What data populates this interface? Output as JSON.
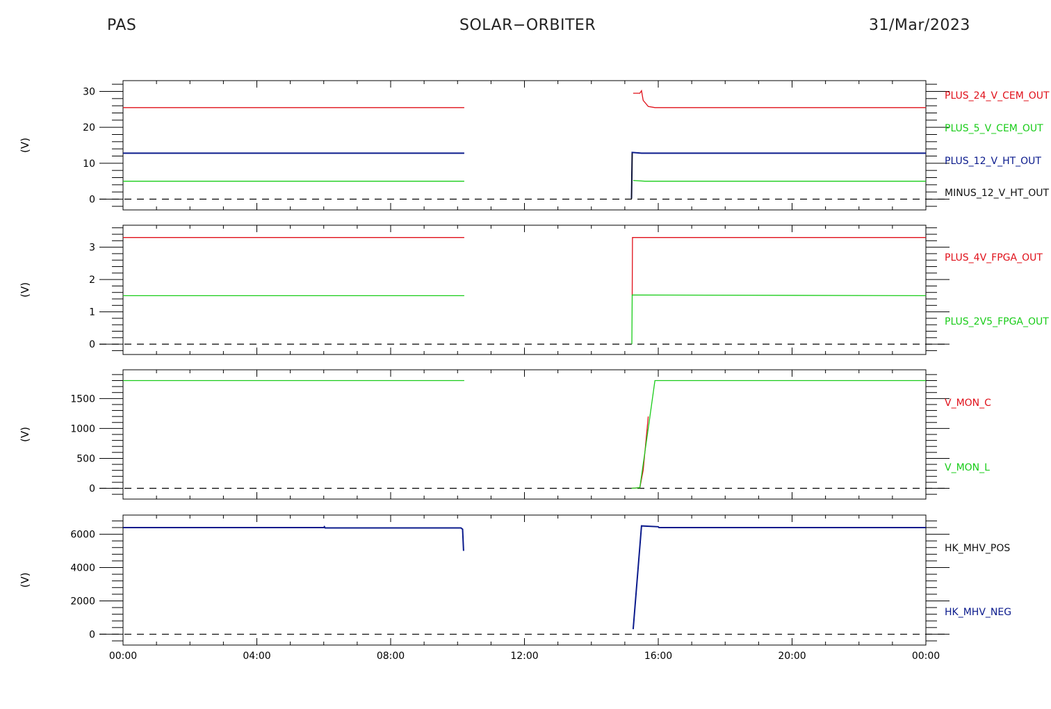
{
  "header": {
    "left": "PAS",
    "center": "SOLAR−ORBITER",
    "right": "31/Mar/2023"
  },
  "x_ticks": [
    "00:00",
    "04:00",
    "08:00",
    "12:00",
    "16:00",
    "20:00",
    "00:00"
  ],
  "chart_data": [
    {
      "type": "line",
      "ylabel": "(V)",
      "ylim": [
        -3,
        33
      ],
      "yticks": [
        0,
        10,
        20,
        30
      ],
      "xlim": [
        0,
        24
      ],
      "series": [
        {
          "name": "PLUS_24_V_CEM_OUT",
          "color": "#e0101a",
          "segments": [
            [
              [
                0,
                25.5
              ],
              [
                10.2,
                25.5
              ]
            ],
            [
              [
                15.25,
                29.5
              ],
              [
                15.45,
                29.5
              ],
              [
                15.5,
                30.2
              ],
              [
                15.55,
                27.5
              ],
              [
                15.7,
                25.8
              ],
              [
                15.9,
                25.5
              ],
              [
                24,
                25.5
              ]
            ]
          ]
        },
        {
          "name": "PLUS_5_V_CEM_OUT",
          "color": "#19cc19",
          "segments": [
            [
              [
                0,
                5.0
              ],
              [
                10.2,
                5.0
              ]
            ],
            [
              [
                15.25,
                5.2
              ],
              [
                15.6,
                5.0
              ],
              [
                24,
                5.0
              ]
            ]
          ]
        },
        {
          "name": "PLUS_12_V_HT_OUT",
          "color": "#0a1a8c",
          "segments": [
            [
              [
                0,
                12.8
              ],
              [
                10.2,
                12.8
              ]
            ],
            [
              [
                15.2,
                0.2
              ],
              [
                15.22,
                13.0
              ],
              [
                15.5,
                12.8
              ],
              [
                24,
                12.8
              ]
            ]
          ]
        },
        {
          "name": "MINUS_12_V_HT_OUT",
          "color": "#111111",
          "segments": [
            [
              [
                15.2,
                0.0
              ],
              [
                15.22,
                12.8
              ]
            ]
          ]
        }
      ]
    },
    {
      "type": "line",
      "ylabel": "(V)",
      "ylim": [
        -0.32,
        3.68
      ],
      "yticks": [
        0,
        1,
        2,
        3
      ],
      "xlim": [
        0,
        24
      ],
      "series": [
        {
          "name": "PLUS_4V_FPGA_OUT",
          "color": "#e0101a",
          "segments": [
            [
              [
                0,
                3.3
              ],
              [
                10.2,
                3.3
              ]
            ],
            [
              [
                15.22,
                1.5
              ],
              [
                15.23,
                3.3
              ],
              [
                24,
                3.3
              ]
            ]
          ]
        },
        {
          "name": "PLUS_2V5_FPGA_OUT",
          "color": "#19cc19",
          "segments": [
            [
              [
                0,
                1.5
              ],
              [
                10.2,
                1.5
              ]
            ],
            [
              [
                15.21,
                0.0
              ],
              [
                15.22,
                1.52
              ],
              [
                24,
                1.5
              ]
            ]
          ]
        }
      ]
    },
    {
      "type": "line",
      "ylabel": "(V)",
      "ylim": [
        -180,
        1980
      ],
      "yticks": [
        0,
        500,
        1000,
        1500
      ],
      "xlim": [
        0,
        24
      ],
      "series": [
        {
          "name": "V_MON_C",
          "color": "#e0101a",
          "segments": [
            [
              [
                15.2,
                0
              ],
              [
                15.45,
                10
              ],
              [
                15.55,
                300
              ],
              [
                15.7,
                1200
              ]
            ]
          ]
        },
        {
          "name": "V_MON_L",
          "color": "#19cc19",
          "segments": [
            [
              [
                0,
                1800
              ],
              [
                10.2,
                1800
              ]
            ],
            [
              [
                15.2,
                0
              ],
              [
                15.45,
                10
              ],
              [
                15.7,
                1000
              ],
              [
                15.9,
                1800
              ],
              [
                24,
                1800
              ]
            ]
          ]
        }
      ]
    },
    {
      "type": "line",
      "ylabel": "(V)",
      "ylim": [
        -650,
        7150
      ],
      "yticks": [
        0,
        2000,
        4000,
        6000
      ],
      "xlim": [
        0,
        24
      ],
      "series": [
        {
          "name": "HK_MHV_POS",
          "color": "#111111",
          "segments": []
        },
        {
          "name": "HK_MHV_NEG",
          "color": "#0a1a8c",
          "segments": [
            [
              [
                0,
                6400
              ],
              [
                6.0,
                6400
              ],
              [
                6.02,
                6450
              ],
              [
                6.04,
                6380
              ],
              [
                10.1,
                6380
              ],
              [
                10.15,
                6300
              ],
              [
                10.18,
                5000
              ]
            ],
            [
              [
                15.25,
                300
              ],
              [
                15.5,
                6500
              ],
              [
                16.0,
                6450
              ],
              [
                16.02,
                6400
              ],
              [
                24,
                6400
              ]
            ]
          ]
        }
      ]
    }
  ]
}
